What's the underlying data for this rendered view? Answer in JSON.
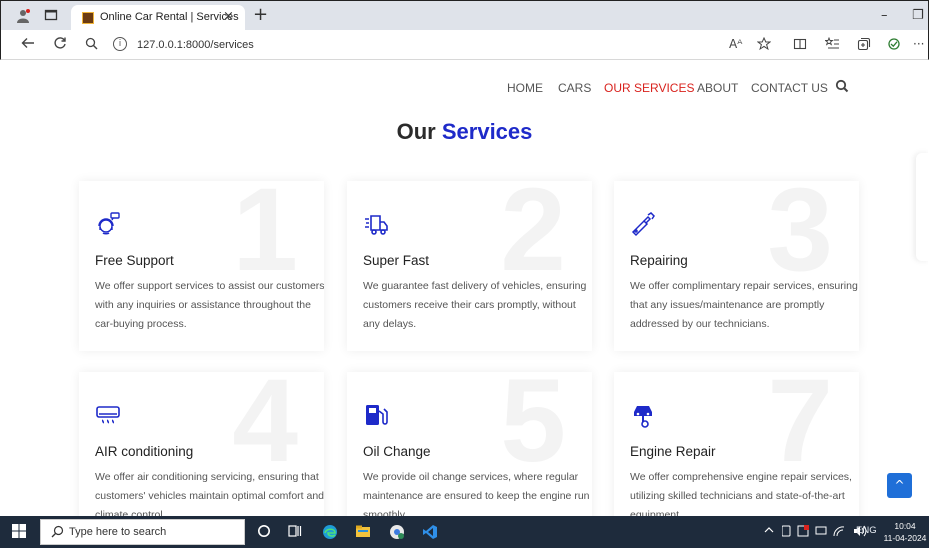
{
  "browser": {
    "tab_title": "Online Car Rental | Services",
    "tab_close": "×",
    "new_tab": "+",
    "url": "127.0.0.1:8000/services",
    "info_glyph": "i",
    "minimize": "–",
    "restore": "❐",
    "more": "···",
    "read_aloud": "Aᴬ"
  },
  "navbar": {
    "items": [
      "HOME",
      "CARS",
      "OUR SERVICES",
      "ABOUT",
      "CONTACT US"
    ],
    "active_index": 2
  },
  "heading": {
    "text": "Our",
    "accent": "Services"
  },
  "services": [
    {
      "num": "1",
      "title": "Free Support",
      "icon": "support-agent-icon",
      "desc": "We offer support services to assist our customers with any inquiries or assistance throughout the car-buying process."
    },
    {
      "num": "2",
      "title": "Super Fast",
      "icon": "fast-truck-icon",
      "desc": "We guarantee fast delivery of vehicles, ensuring customers receive their cars promptly, without any delays."
    },
    {
      "num": "3",
      "title": "Repairing",
      "icon": "wrench-icon",
      "desc": "We offer complimentary repair services, ensuring that any issues/maintenance are promptly addressed by our technicians."
    },
    {
      "num": "4",
      "title": "AIR conditioning",
      "icon": "air-conditioner-icon",
      "desc": "We offer air conditioning servicing, ensuring that customers' vehicles maintain optimal comfort and climate control."
    },
    {
      "num": "5",
      "title": "Oil Change",
      "icon": "fuel-pump-icon",
      "desc": "We provide oil change services, where regular maintenance are ensured to keep the engine run smoothly."
    },
    {
      "num": "7",
      "title": "Engine Repair",
      "icon": "car-lift-icon",
      "desc": "We offer comprehensive engine repair services, utilizing skilled technicians and state-of-the-art equipment."
    }
  ],
  "back_to_top": "^",
  "taskbar": {
    "search_placeholder": "Type here to search",
    "tray_text": "ENG",
    "time": "10:04",
    "date": "11-04-2024"
  },
  "colors": {
    "accent_blue": "#1e2ac9",
    "active_nav_red": "#d9231e",
    "taskbar": "#1e2b3c",
    "back_to_top": "#1f6fd8"
  }
}
